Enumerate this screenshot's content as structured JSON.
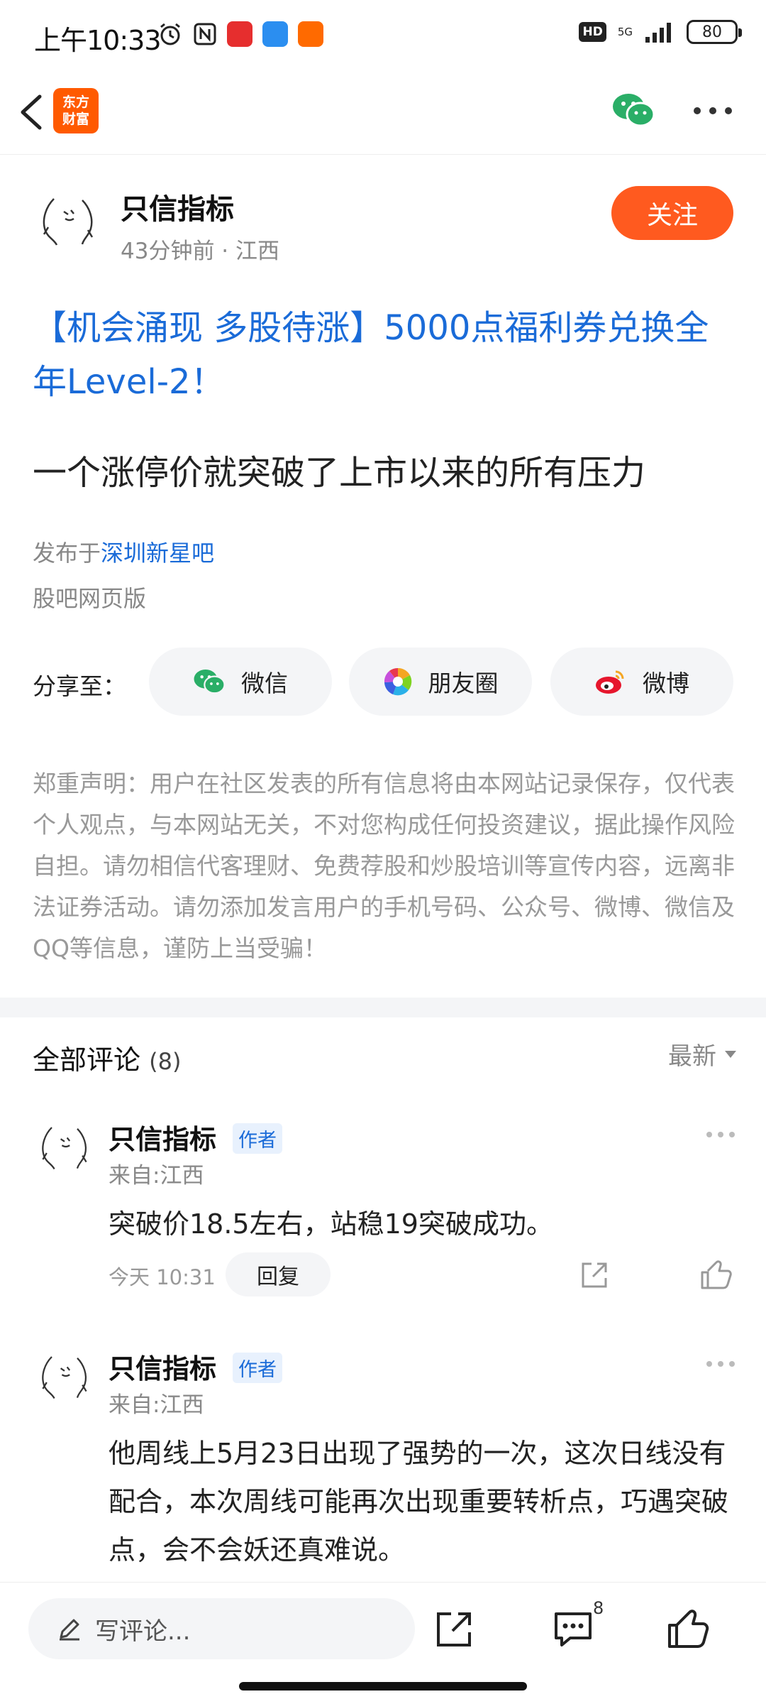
{
  "status_bar": {
    "time": "上午10:33",
    "network": "5G",
    "battery": "80",
    "hd": "HD"
  },
  "nav": {
    "logo_line1": "东方",
    "logo_line2": "财富"
  },
  "author": {
    "name": "只信指标",
    "meta": "43分钟前 · 江西",
    "follow_label": "关注"
  },
  "post": {
    "title": "【机会涌现 多股待涨】5000点福利券兑换全年Level-2！",
    "subtitle": "一个涨停价就突破了上市以来的所有压力",
    "published_prefix": "发布于",
    "published_link": "深圳新星吧",
    "platform": "股吧网页版"
  },
  "share": {
    "label": "分享至：",
    "wechat": "微信",
    "moments": "朋友圈",
    "weibo": "微博"
  },
  "disclaimer": "郑重声明：用户在社区发表的所有信息将由本网站记录保存，仅代表个人观点，与本网站无关，不对您构成任何投资建议，据此操作风险自担。请勿相信代客理财、免费荐股和炒股培训等宣传内容，远离非法证券活动。请勿添加发言用户的手机号码、公众号、微博、微信及QQ等信息，谨防上当受骗！",
  "comments": {
    "title": "全部评论",
    "count": "(8)",
    "sort": "最新",
    "items": [
      {
        "name": "只信指标",
        "badge": "作者",
        "location": "来自:江西",
        "text": "突破价18.5左右，站稳19突破成功。",
        "time": "今天 10:31",
        "reply": "回复"
      },
      {
        "name": "只信指标",
        "badge": "作者",
        "location": "来自:江西",
        "text": "他周线上5月23日出现了强势的一次，这次日线没有配合，本次周线可能再次出现重要转析点，巧遇突破点，会不会妖还真难说。"
      }
    ]
  },
  "bottom_bar": {
    "input_placeholder": "写评论...",
    "comment_count": "8"
  },
  "colors": {
    "accent": "#ff5a1f",
    "link": "#1a6bd8",
    "muted": "#888888"
  }
}
